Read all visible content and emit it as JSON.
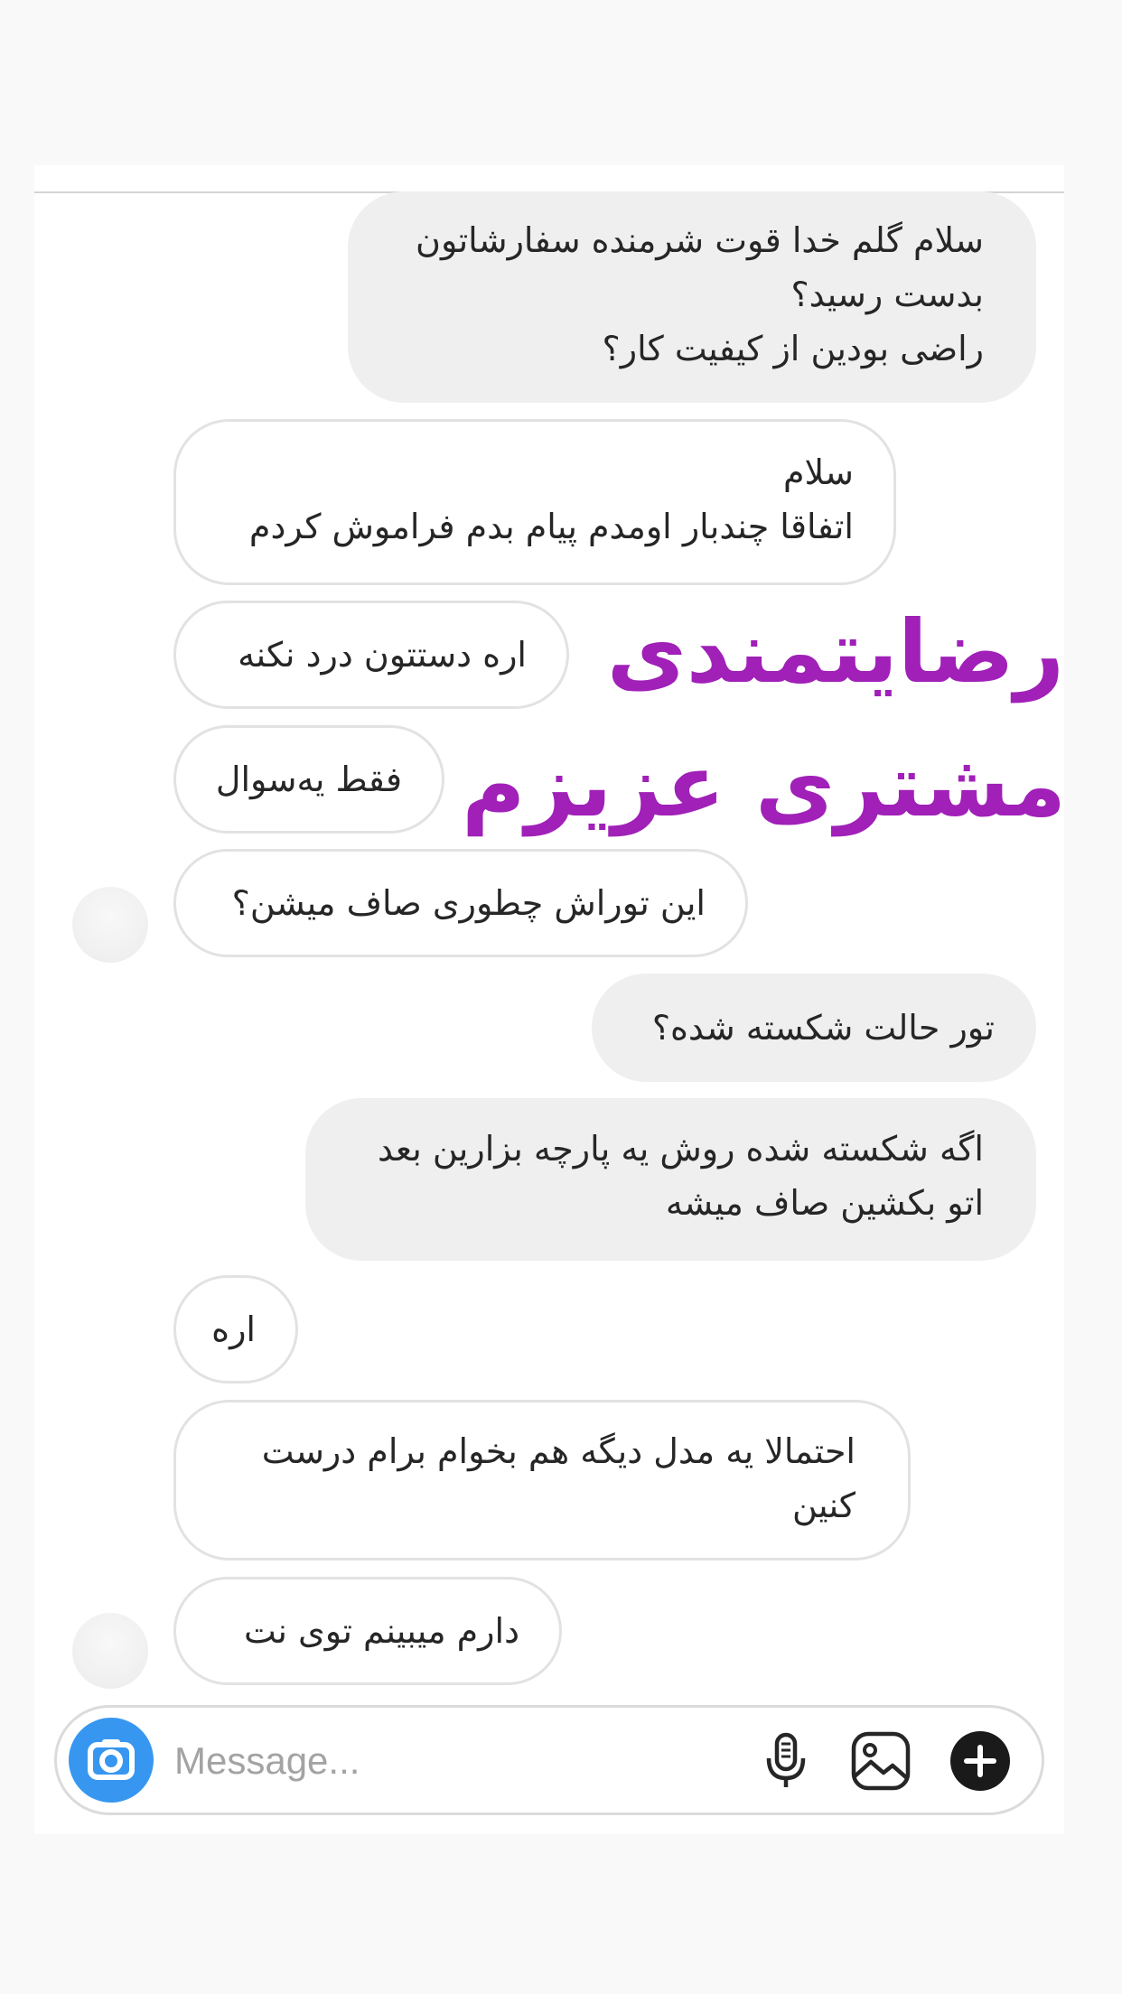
{
  "conversation": {
    "messages": [
      {
        "side": "sent",
        "text": "سلام گلم خدا قوت شرمنده سفارشاتون\nبدست رسید؟\nراضی بودین از کیفیت کار؟"
      },
      {
        "side": "received",
        "text": "سلام\nاتفاقا چندبار اومدم پیام بدم فراموش کردم"
      },
      {
        "side": "received",
        "text": "اره دستتون درد نکنه"
      },
      {
        "side": "received",
        "text": "فقط یه‌سوال"
      },
      {
        "side": "received",
        "text": "این توراش چطوری صاف میشن؟"
      },
      {
        "side": "sent",
        "text": "تور حالت شکسته شده؟"
      },
      {
        "side": "sent",
        "text": "اگه شکسته شده روش یه پارچه بزارین بعد\nاتو بکشین صاف میشه"
      },
      {
        "side": "received",
        "text": "اره"
      },
      {
        "side": "received",
        "text": "احتمالا یه مدل دیگه هم بخوام برام درست\nکنین"
      },
      {
        "side": "received",
        "text": "دارم میبینم توی نت"
      }
    ]
  },
  "overlay": {
    "line1": "رضایتمندی",
    "line2": "مشتری عزیزم",
    "color": "#a020b8"
  },
  "composer": {
    "placeholder": "Message...",
    "icons": {
      "camera": "camera-icon",
      "microphone": "microphone-icon",
      "gallery": "gallery-icon",
      "add": "plus-icon"
    },
    "accent": "#3797f0"
  }
}
